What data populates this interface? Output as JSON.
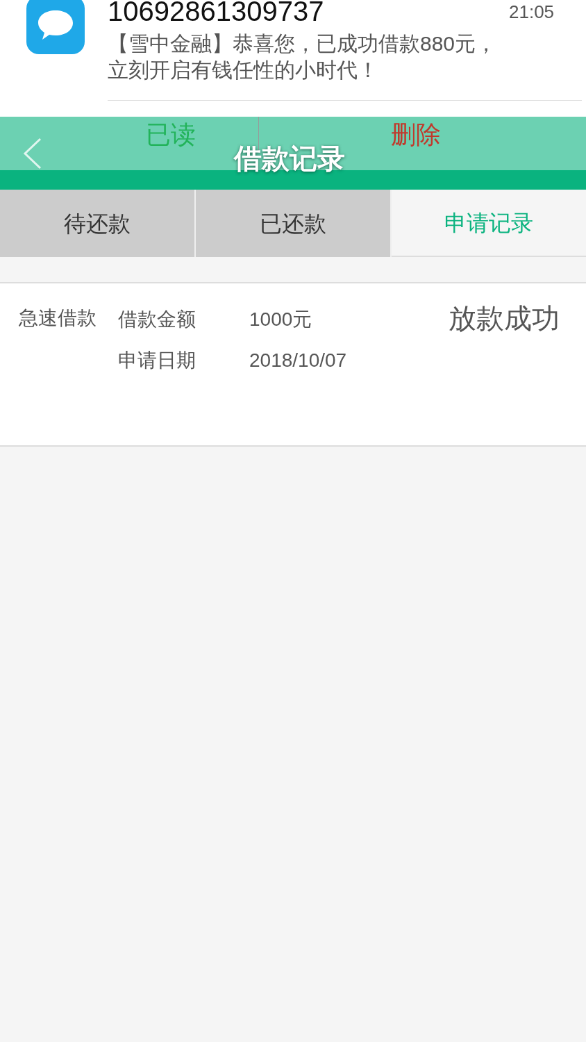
{
  "notification": {
    "sender": "10692861309737",
    "time": "21:05",
    "message": "【雪中金融】恭喜您，已成功借款880元，立刻开启有钱任性的小时代！",
    "actions": [
      {
        "label": "已读",
        "kind": "primary"
      },
      {
        "label": "删除",
        "kind": "danger"
      }
    ]
  },
  "header": {
    "title": "借款记录"
  },
  "tabs": [
    {
      "label": "待还款",
      "selected": false
    },
    {
      "label": "已还款",
      "selected": false
    },
    {
      "label": "申请记录",
      "selected": true
    }
  ],
  "records": [
    {
      "type": "急速借款",
      "status": "放款成功",
      "fields": [
        {
          "label": "借款金额",
          "value": "1000元"
        },
        {
          "label": "申请日期",
          "value": "2018/10/07"
        }
      ]
    }
  ]
}
